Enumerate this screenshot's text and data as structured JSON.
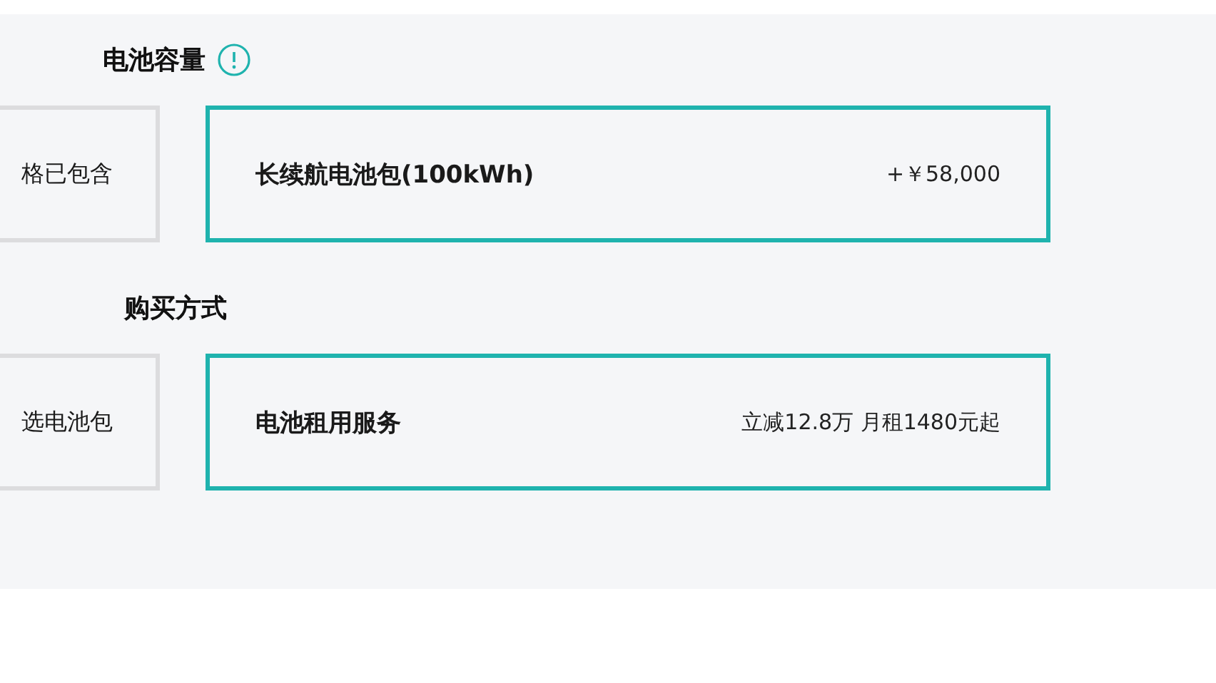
{
  "sections": [
    {
      "title": "电池容量",
      "info": true,
      "options": [
        {
          "label": "格已包含",
          "selected": false
        },
        {
          "label": "长续航电池包(100kWh)",
          "price": "+￥58,000",
          "selected": true
        }
      ]
    },
    {
      "title": "购买方式",
      "info": false,
      "options": [
        {
          "label": "选电池包",
          "selected": false
        },
        {
          "label": "电池租用服务",
          "price": "立减12.8万 月租1480元起",
          "selected": true
        }
      ]
    }
  ]
}
